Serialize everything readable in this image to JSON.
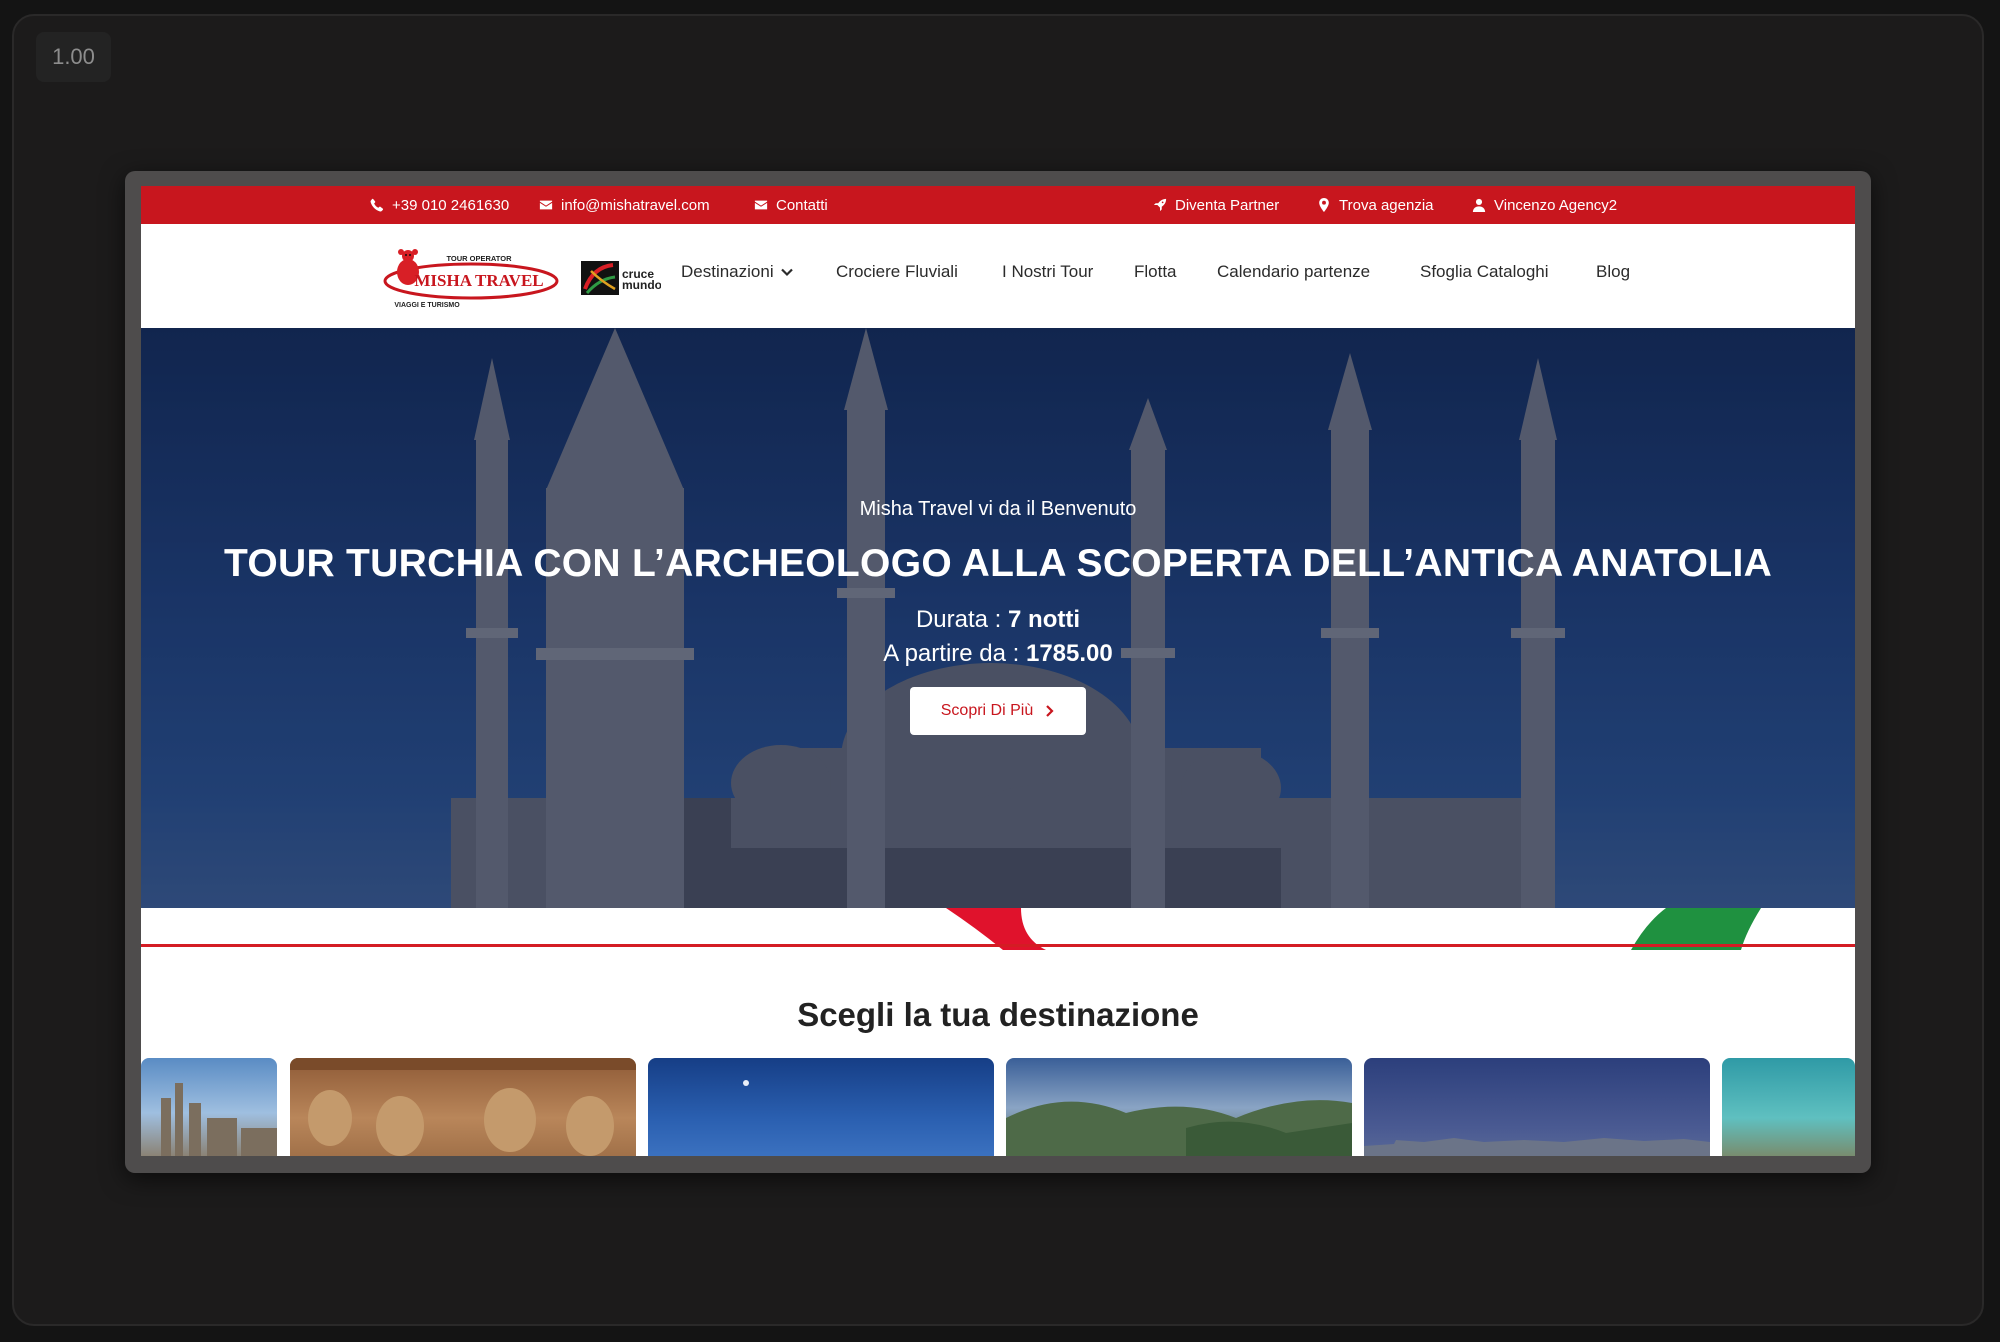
{
  "viewer": {
    "zoom_label": "1.00"
  },
  "topbar": {
    "phone": "+39 010 2461630",
    "email": "info@mishatravel.com",
    "contact": "Contatti",
    "partner": "Diventa Partner",
    "find_agency": "Trova agenzia",
    "user": "Vincenzo Agency2"
  },
  "logo": {
    "misha_top": "TOUR OPERATOR",
    "misha_name": "MISHA TRAVEL",
    "misha_sub": "VIAGGI E TURISMO",
    "cruce_line1": "cruce",
    "cruce_line2": "mundo"
  },
  "nav": {
    "items": [
      "Destinazioni",
      "Crociere Fluviali",
      "I Nostri Tour",
      "Flotta",
      "Calendario partenze",
      "Sfoglia Cataloghi",
      "Blog"
    ]
  },
  "hero": {
    "welcome": "Misha Travel vi da il Benvenuto",
    "title": "TOUR TURCHIA CON L’ARCHEOLOGO ALLA SCOPERTA DELL’ANTICA ANATOLIA",
    "duration_label": "Durata : ",
    "duration_value": "7 notti",
    "price_label": "A partire da : ",
    "price_value": "1785.00",
    "button_label": "Scopri Di Più"
  },
  "destinations": {
    "title": "Scegli la tua destinazione"
  },
  "colors": {
    "brand_red": "#c8161e",
    "accent_green": "#1f9140"
  }
}
